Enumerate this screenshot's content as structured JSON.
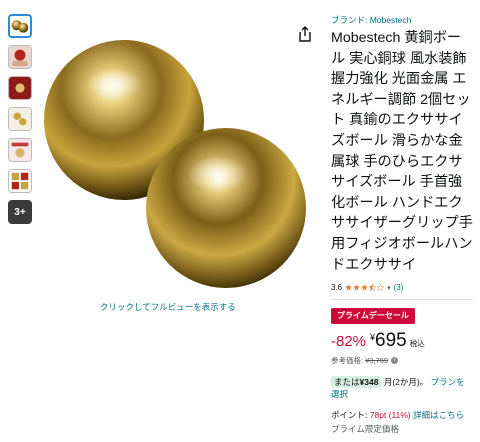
{
  "colors": {
    "accent_link": "#007185",
    "deal_red": "#cc0c39",
    "active_thumb": "#2f8bd6",
    "install_chip_bg": "#d8f0e4",
    "gold": "#c9a43c"
  },
  "gallery": {
    "thumbnails": [
      {
        "name": "thumb-gold-balls",
        "active": true
      },
      {
        "name": "thumb-hand-photo",
        "active": false
      },
      {
        "name": "thumb-red-product",
        "active": false
      },
      {
        "name": "thumb-balls-closeup",
        "active": false
      },
      {
        "name": "thumb-hand-usage",
        "active": false
      },
      {
        "name": "thumb-info-grid",
        "active": false
      }
    ],
    "more_label": "3+",
    "fullview_link": "クリックしてフルビューを表示する",
    "share_icon": "share-icon"
  },
  "product": {
    "brand": "ブランド: Mobestech",
    "title": "Mobestech 黄銅ボール 実心銅球 風水装飾 握力強化 光面金属 エネルギー調節 2個セット 真鍮のエクササイズボール 滑らかな金属球 手のひらエクササイズボール 手首強化ボール ハンドエクササイザーグリップ手用フィジオボールハンドエクササイ",
    "rating": {
      "value": "3.6",
      "stars": 3.5,
      "count": "(3)"
    },
    "deal_badge": "プライムデーセール",
    "price": {
      "discount": "-82%",
      "currency": "¥",
      "amount": "695",
      "tax_note": "税込",
      "reference_label": "参考価格:",
      "reference_price": "¥3,769",
      "info_icon": "info-icon"
    },
    "installment": {
      "prefix": "または",
      "amount": "¥348",
      "period": "月(2か月)。",
      "link": "プランを選択"
    },
    "points": {
      "label": "ポイント:",
      "value": "78pt",
      "percent": "(11%)",
      "link": "詳細はこちら"
    },
    "prime_note": "プライム限定価格"
  }
}
